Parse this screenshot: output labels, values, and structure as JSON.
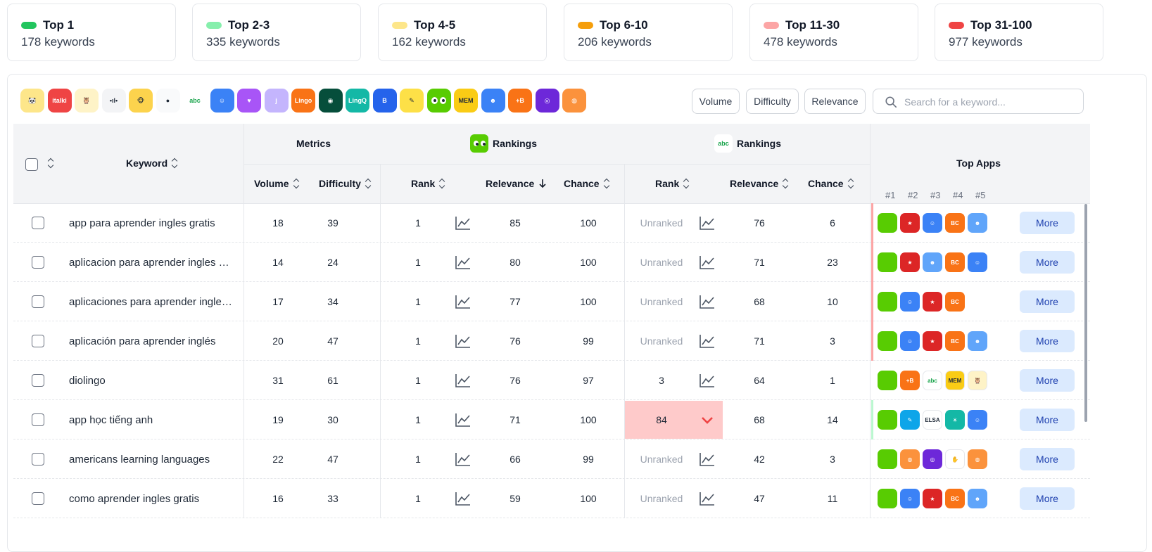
{
  "stats": [
    {
      "title": "Top 1",
      "count": "178 keywords",
      "color": "#22c55e"
    },
    {
      "title": "Top 2-3",
      "count": "335 keywords",
      "color": "#86efac"
    },
    {
      "title": "Top 4-5",
      "count": "162 keywords",
      "color": "#fde68a"
    },
    {
      "title": "Top 6-10",
      "count": "206 keywords",
      "color": "#f59e0b"
    },
    {
      "title": "Top 11-30",
      "count": "478 keywords",
      "color": "#fca5a5"
    },
    {
      "title": "Top 31-100",
      "count": "977 keywords",
      "color": "#ef4444"
    }
  ],
  "apps": [
    {
      "name": "panda-app-icon",
      "bg": "#fde68a",
      "label": "🐼"
    },
    {
      "name": "italki-app-icon",
      "bg": "#ef4444",
      "label": "italki"
    },
    {
      "name": "owl-app-icon",
      "bg": "#fef3c7",
      "label": "🦉"
    },
    {
      "name": "voice-app-icon",
      "bg": "#f3f4f6",
      "label": "•ıl•"
    },
    {
      "name": "monkey-app-icon",
      "bg": "#fcd34d",
      "label": "🐵"
    },
    {
      "name": "leaf-app-icon",
      "bg": "#f9fafb",
      "label": "●"
    },
    {
      "name": "abc-app-icon",
      "bg": "#ffffff",
      "label": "abc"
    },
    {
      "name": "robot-app-icon",
      "bg": "#3b82f6",
      "label": "☺"
    },
    {
      "name": "gradient-app-icon",
      "bg": "#a855f7",
      "label": "♥"
    },
    {
      "name": "j-app-icon",
      "bg": "#c4b5fd",
      "label": "j"
    },
    {
      "name": "lingo-play-app-icon",
      "bg": "#f97316",
      "label": "Lingo"
    },
    {
      "name": "headphones-app-icon",
      "bg": "#064e3b",
      "label": "◉"
    },
    {
      "name": "lingq-app-icon",
      "bg": "#14b8a6",
      "label": "LingQ"
    },
    {
      "name": "b-app-icon",
      "bg": "#2563eb",
      "label": "B"
    },
    {
      "name": "feather-app-icon",
      "bg": "#fde047",
      "label": "✎"
    },
    {
      "name": "duolingo-app-icon",
      "bg": "#58cc02",
      "label": "eyes"
    },
    {
      "name": "memrise-app-icon",
      "bg": "#facc15",
      "label": "MEM"
    },
    {
      "name": "smile-app-icon",
      "bg": "#3b82f6",
      "label": "☻"
    },
    {
      "name": "plus-b-app-icon",
      "bg": "#f97316",
      "label": "+B"
    },
    {
      "name": "drop-app-icon",
      "bg": "#6d28d9",
      "label": "◎"
    },
    {
      "name": "globe-app-icon",
      "bg": "#fb923c",
      "label": "◍"
    }
  ],
  "filters": {
    "volume": "Volume",
    "difficulty": "Difficulty",
    "relevance": "Relevance"
  },
  "search": {
    "placeholder": "Search for a keyword..."
  },
  "header": {
    "keyword": "Keyword",
    "metrics": "Metrics",
    "rankings_a": "Rankings",
    "rankings_b": "Rankings",
    "top_apps": "Top Apps",
    "volume": "Volume",
    "difficulty": "Difficulty",
    "rank": "Rank",
    "relevance": "Relevance",
    "chance": "Chance",
    "rank2": "Rank",
    "relevance2": "Relevance",
    "chance2": "Chance",
    "pos1": "#1",
    "pos2": "#2",
    "pos3": "#3",
    "pos4": "#4",
    "pos5": "#5"
  },
  "rows": [
    {
      "keyword": "app para aprender ingles gratis",
      "volume": "18",
      "difficulty": "39",
      "rank": "1",
      "relevance": "85",
      "chance": "100",
      "rank2": "Unranked",
      "relevance2": "76",
      "chance2": "6",
      "more": "More"
    },
    {
      "keyword": "aplicacion para aprender ingles gratis",
      "volume": "14",
      "difficulty": "24",
      "rank": "1",
      "relevance": "80",
      "chance": "100",
      "rank2": "Unranked",
      "relevance2": "71",
      "chance2": "23",
      "more": "More"
    },
    {
      "keyword": "aplicaciones para aprender ingles gratis",
      "volume": "17",
      "difficulty": "34",
      "rank": "1",
      "relevance": "77",
      "chance": "100",
      "rank2": "Unranked",
      "relevance2": "68",
      "chance2": "10",
      "more": "More"
    },
    {
      "keyword": "aplicación para aprender inglés",
      "volume": "20",
      "difficulty": "47",
      "rank": "1",
      "relevance": "76",
      "chance": "99",
      "rank2": "Unranked",
      "relevance2": "71",
      "chance2": "3",
      "more": "More"
    },
    {
      "keyword": "diolingo",
      "volume": "31",
      "difficulty": "61",
      "rank": "1",
      "relevance": "76",
      "chance": "97",
      "rank2": "3",
      "relevance2": "64",
      "chance2": "1",
      "more": "More"
    },
    {
      "keyword": "app học tiếng anh",
      "volume": "19",
      "difficulty": "30",
      "rank": "1",
      "relevance": "71",
      "chance": "100",
      "rank2": "84",
      "relevance2": "68",
      "chance2": "14",
      "more": "More"
    },
    {
      "keyword": "americans learning languages",
      "volume": "22",
      "difficulty": "47",
      "rank": "1",
      "relevance": "66",
      "chance": "99",
      "rank2": "Unranked",
      "relevance2": "42",
      "chance2": "3",
      "more": "More"
    },
    {
      "keyword": "como aprender ingles gratis",
      "volume": "16",
      "difficulty": "33",
      "rank": "1",
      "relevance": "59",
      "chance": "100",
      "rank2": "Unranked",
      "relevance2": "47",
      "chance2": "11",
      "more": "More"
    }
  ]
}
